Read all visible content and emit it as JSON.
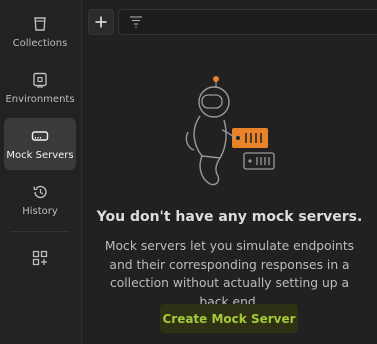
{
  "sidebar": {
    "items": [
      {
        "label": "Collections",
        "icon": "collections-icon",
        "active": false
      },
      {
        "label": "Environments",
        "icon": "environments-icon",
        "active": false
      },
      {
        "label": "Mock Servers",
        "icon": "mock-servers-icon",
        "active": true
      },
      {
        "label": "History",
        "icon": "history-icon",
        "active": false
      }
    ],
    "extra_icon": "add-apps-icon"
  },
  "toolbar": {
    "new_icon": "plus-icon",
    "filter_icon": "filter-icon",
    "search_value": ""
  },
  "empty_state": {
    "title": "You don't have any mock servers.",
    "description": "Mock servers let you simulate endpoints and their corresponding responses in a collection without actually setting up a back end.",
    "cta_label": "Create Mock Server"
  },
  "colors": {
    "background": "#212121",
    "active_nav": "#3a3a3a",
    "accent_orange": "#e8832a",
    "cta_text": "#a6c93a",
    "cta_background": "#2f3115"
  }
}
